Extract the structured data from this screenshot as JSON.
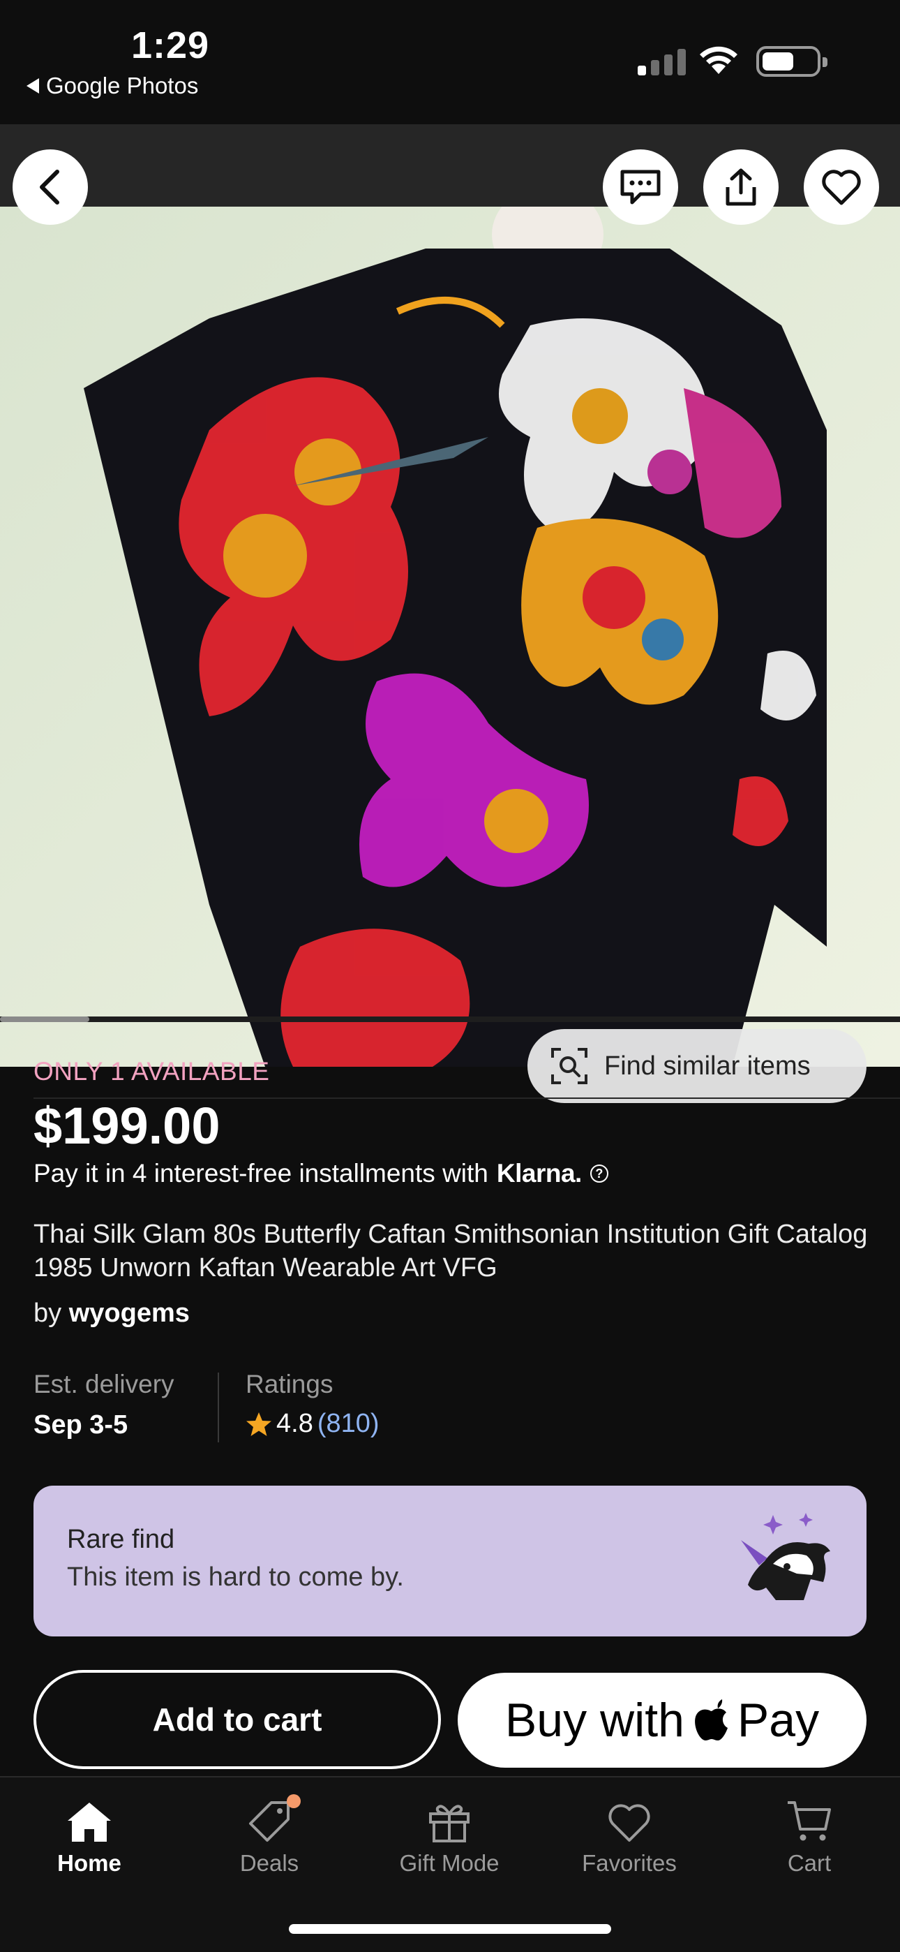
{
  "status_bar": {
    "time": "1:29",
    "back_app_label": "Google Photos"
  },
  "gallery": {
    "find_similar_label": "Find similar items",
    "image_description": "black silk caftan with colorful butterfly print"
  },
  "listing": {
    "availability": "ONLY 1 AVAILABLE",
    "price": "$199.00",
    "installments_text": "Pay it in 4 interest-free installments with",
    "installments_brand": "Klarna.",
    "title": "Thai Silk Glam 80s Butterfly Caftan Smithsonian Institution Gift Catalog 1985 Unworn Kaftan Wearable Art VFG",
    "by_prefix": "by",
    "seller": "wyogems",
    "delivery_label": "Est. delivery",
    "delivery_value": "Sep 3-5",
    "ratings_label": "Ratings",
    "rating": "4.8",
    "rating_count": "(810)"
  },
  "rare_find": {
    "heading": "Rare find",
    "subtext": "This item is hard to come by."
  },
  "actions": {
    "add_to_cart": "Add to cart",
    "buy_with": "Buy with",
    "pay": "Pay"
  },
  "tabs": [
    {
      "label": "Home",
      "icon": "home-icon",
      "active": true
    },
    {
      "label": "Deals",
      "icon": "tag-icon",
      "active": false
    },
    {
      "label": "Gift Mode",
      "icon": "gift-icon",
      "active": false
    },
    {
      "label": "Favorites",
      "icon": "heart-icon",
      "active": false
    },
    {
      "label": "Cart",
      "icon": "cart-icon",
      "active": false
    }
  ],
  "colors": {
    "background": "#0e0e0e",
    "availability": "#f2a2c0",
    "rare_find_bg": "#cfc4e6",
    "rating_count": "#8fb4f2",
    "star": "#f5a623"
  }
}
